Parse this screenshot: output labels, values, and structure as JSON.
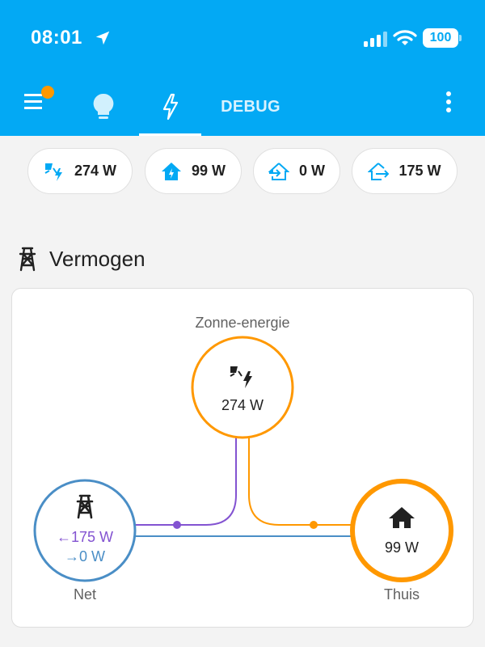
{
  "status": {
    "time": "08:01",
    "battery": "100"
  },
  "tabs": {
    "debug": "DEBUG"
  },
  "chips": [
    {
      "value": "274 W",
      "icon": "solar-power-icon",
      "color": "#03a9f4"
    },
    {
      "value": "99 W",
      "icon": "home-lightning-icon",
      "color": "#03a9f4"
    },
    {
      "value": "0 W",
      "icon": "home-import-icon",
      "color": "#03a9f4"
    },
    {
      "value": "175 W",
      "icon": "home-export-icon",
      "color": "#03a9f4"
    }
  ],
  "section": {
    "title": "Vermogen",
    "icon": "transmission-tower-icon"
  },
  "flow": {
    "solar": {
      "label": "Zonne-energie",
      "value": "274 W",
      "color": "#ff9800"
    },
    "grid": {
      "label": "Net",
      "from_grid": "←175 W",
      "to_grid": "→0 W",
      "color": "#4a8ec6",
      "return_color": "#8353d1"
    },
    "home": {
      "label": "Thuis",
      "value": "99 W",
      "color": "#ff9800"
    }
  },
  "colors": {
    "header": "#03a9f4",
    "badge": "#ff9800"
  }
}
